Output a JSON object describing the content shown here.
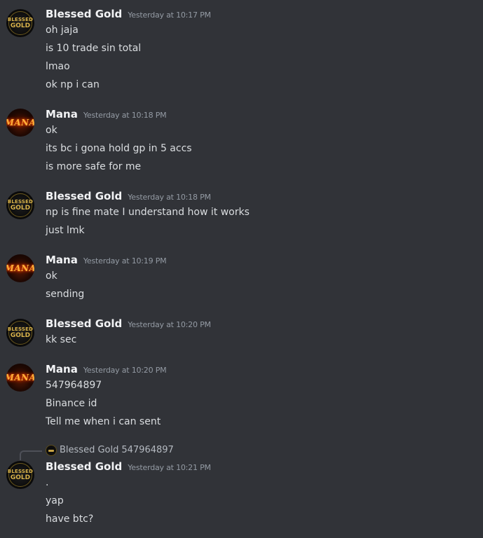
{
  "messages": [
    {
      "author": "Blessed Gold",
      "avatar": "gold-bars-logo-icon",
      "timestamp": "Yesterday at 10:17 PM",
      "lines": [
        "oh jaja",
        "is 10 trade sin total",
        "lmao",
        "ok np i can"
      ]
    },
    {
      "author": "Mana",
      "avatar": "mana-fire-logo-icon",
      "timestamp": "Yesterday at 10:18 PM",
      "lines": [
        "ok",
        "its bc i gona hold gp in 5 accs",
        "is more safe for me"
      ]
    },
    {
      "author": "Blessed Gold",
      "avatar": "gold-bars-logo-icon",
      "timestamp": "Yesterday at 10:18 PM",
      "lines": [
        "np is fine mate I understand how it works",
        "just lmk"
      ]
    },
    {
      "author": "Mana",
      "avatar": "mana-fire-logo-icon",
      "timestamp": "Yesterday at 10:19 PM",
      "lines": [
        "ok",
        "sending"
      ]
    },
    {
      "author": "Blessed Gold",
      "avatar": "gold-bars-logo-icon",
      "timestamp": "Yesterday at 10:20 PM",
      "lines": [
        "kk sec"
      ]
    },
    {
      "author": "Mana",
      "avatar": "mana-fire-logo-icon",
      "timestamp": "Yesterday at 10:20 PM",
      "lines": [
        "547964897",
        "Binance id",
        "Tell me when i can sent"
      ]
    },
    {
      "author": "Blessed Gold",
      "avatar": "gold-bars-logo-icon",
      "timestamp": "Yesterday at 10:21 PM",
      "reply_to": {
        "author": "Blessed Gold",
        "text": "547964897"
      },
      "lines": [
        ".",
        "yap",
        "have btc?"
      ]
    }
  ],
  "avatar_text": {
    "gold_top": "BLESSED",
    "gold_bottom": "GOLD",
    "mana": "MANA"
  },
  "colors": {
    "background": "#313338",
    "author": "#f2f3f5",
    "timestamp": "#949ba4",
    "message": "#dbdee1"
  }
}
